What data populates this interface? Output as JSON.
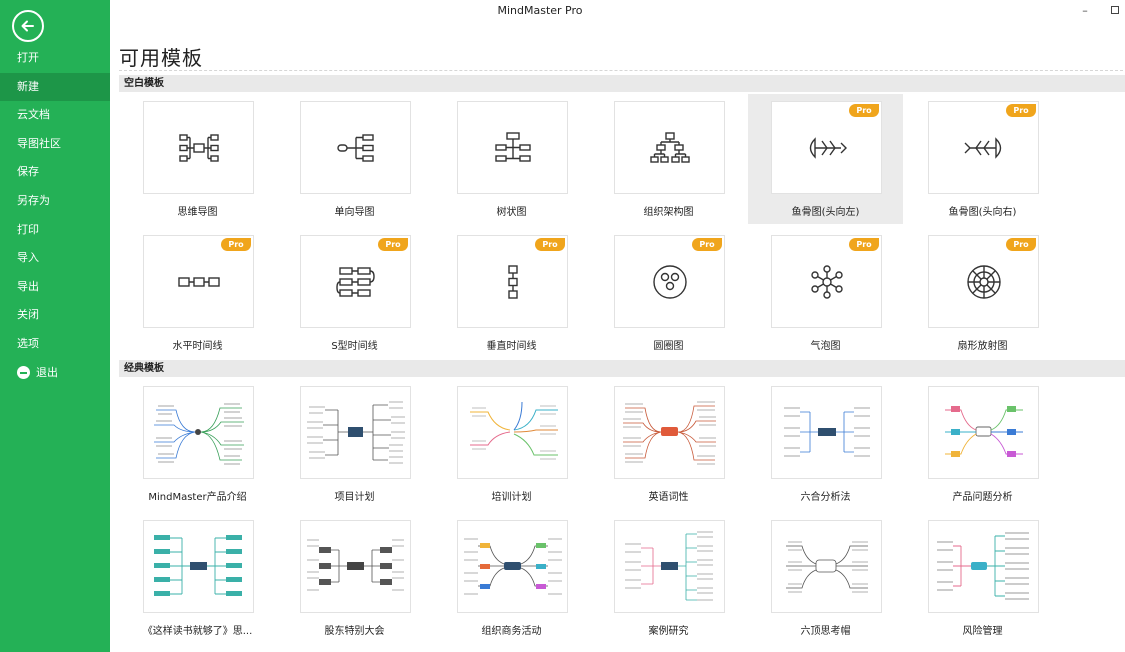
{
  "window": {
    "title": "MindMaster Pro",
    "minimize_label": "–"
  },
  "sidebar": {
    "items": [
      {
        "label": "打开"
      },
      {
        "label": "新建"
      },
      {
        "label": "云文档"
      },
      {
        "label": "导图社区"
      },
      {
        "label": "保存"
      },
      {
        "label": "另存为"
      },
      {
        "label": "打印"
      },
      {
        "label": "导入"
      },
      {
        "label": "导出"
      },
      {
        "label": "关闭"
      },
      {
        "label": "选项"
      },
      {
        "label": "退出"
      }
    ],
    "active_index": 1,
    "accent": "#24b156"
  },
  "page_title": "可用模板",
  "blank_section": {
    "title": "空白模板",
    "pro_badge": "Pro",
    "templates": [
      {
        "label": "思维导图",
        "pro": false,
        "icon": "mindmap-icon"
      },
      {
        "label": "单向导图",
        "pro": false,
        "icon": "right-map-icon"
      },
      {
        "label": "树状图",
        "pro": false,
        "icon": "tree-icon"
      },
      {
        "label": "组织架构图",
        "pro": false,
        "icon": "org-chart-icon"
      },
      {
        "label": "鱼骨图(头向左)",
        "pro": true,
        "icon": "fishbone-left-icon",
        "selected": true
      },
      {
        "label": "鱼骨图(头向右)",
        "pro": true,
        "icon": "fishbone-right-icon"
      },
      {
        "label": "水平时间线",
        "pro": true,
        "icon": "horizontal-timeline-icon"
      },
      {
        "label": "S型时间线",
        "pro": true,
        "icon": "s-timeline-icon"
      },
      {
        "label": "垂直时间线",
        "pro": true,
        "icon": "vertical-timeline-icon"
      },
      {
        "label": "圆圈图",
        "pro": true,
        "icon": "circle-map-icon"
      },
      {
        "label": "气泡图",
        "pro": true,
        "icon": "bubble-map-icon"
      },
      {
        "label": "扇形放射图",
        "pro": true,
        "icon": "sector-radial-icon"
      }
    ]
  },
  "classic_section": {
    "title": "经典模板",
    "templates": [
      {
        "label": "MindMaster产品介绍"
      },
      {
        "label": "项目计划"
      },
      {
        "label": "培训计划"
      },
      {
        "label": "英语词性"
      },
      {
        "label": "六合分析法"
      },
      {
        "label": "产品问题分析"
      },
      {
        "label": "《这样读书就够了》思..."
      },
      {
        "label": "股东特别大会"
      },
      {
        "label": "组织商务活动"
      },
      {
        "label": "案例研究"
      },
      {
        "label": "六顶思考帽"
      },
      {
        "label": "风险管理"
      }
    ]
  }
}
